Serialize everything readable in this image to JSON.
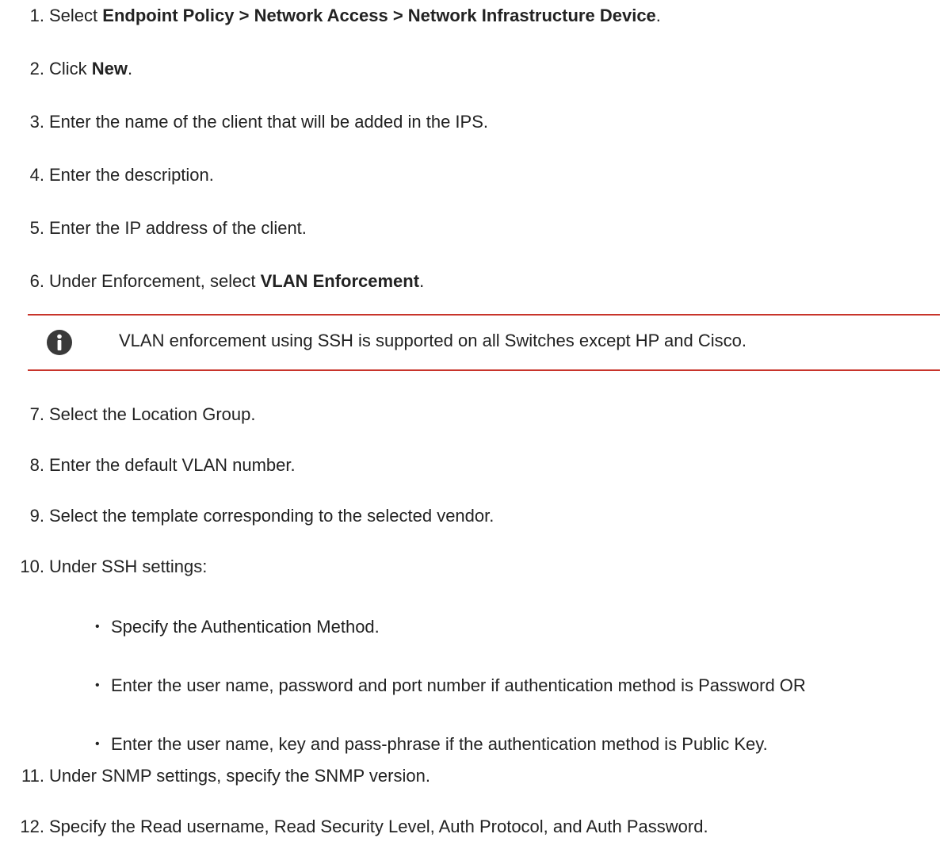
{
  "steps": [
    {
      "num": "1.",
      "pre": "Select ",
      "bold": "Endpoint Policy > Network Access > Network Infrastructure Device",
      "post": "."
    },
    {
      "num": "2.",
      "pre": "Click ",
      "bold": "New",
      "post": "."
    },
    {
      "num": "3.",
      "text": "Enter the name of the client that will be added in the IPS."
    },
    {
      "num": "4.",
      "text": "Enter the description."
    },
    {
      "num": "5.",
      "text": "Enter the IP address of the client."
    },
    {
      "num": "6.",
      "pre": "Under Enforcement, select ",
      "bold": "VLAN Enforcement",
      "post": "."
    },
    {
      "num": "7.",
      "text": "Select the Location Group."
    },
    {
      "num": "8.",
      "text": "Enter the default VLAN number."
    },
    {
      "num": "9.",
      "text": "Select the template corresponding to the selected vendor."
    },
    {
      "num": "10.",
      "text": "Under SSH settings:"
    },
    {
      "num": "11.",
      "text": "Under SNMP settings, specify the SNMP version."
    },
    {
      "num": "12.",
      "text": "Specify the Read username, Read Security Level, Auth Protocol, and Auth Password."
    }
  ],
  "note": {
    "icon": "info-icon",
    "text": "VLAN enforcement using SSH is supported on all Switches except HP and Cisco.",
    "border_color": "#c8342b"
  },
  "ssh_bullets": [
    "Specify the Authentication Method.",
    "Enter the user name, password and port number if authentication method is Password OR",
    "Enter the user name, key and pass-phrase if the authentication method is Public Key."
  ]
}
